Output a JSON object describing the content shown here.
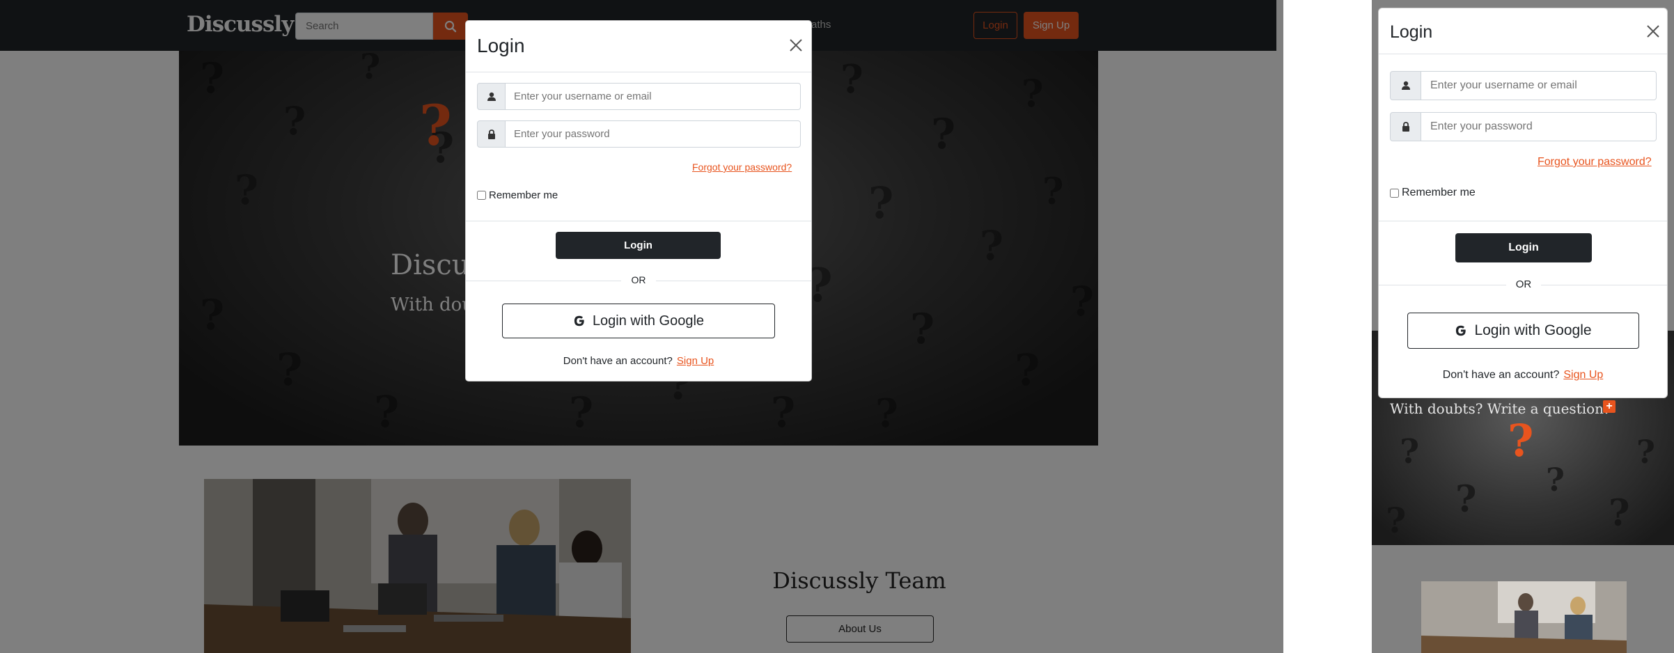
{
  "navbar": {
    "brand": "Discussly",
    "search_placeholder": "Search",
    "partial_link": "aths",
    "login_label": "Login",
    "signup_label": "Sign Up"
  },
  "hero": {
    "title": "Discussly",
    "subtitle": "With doubts? Write a question!"
  },
  "team": {
    "title": "Discussly Team",
    "about_label": "About Us"
  },
  "login_modal": {
    "title": "Login",
    "username_placeholder": "Enter your username or email",
    "password_placeholder": "Enter your password",
    "forgot_label": "Forgot your password?",
    "remember_label": "Remember me",
    "login_button": "Login",
    "or_text": "OR",
    "google_button": "Login with Google",
    "no_account_text": "Don't have an account?",
    "signup_link": "Sign Up"
  },
  "mobile": {
    "hero_subtitle": "With doubts? Write a question!",
    "plus_icon": "+"
  },
  "colors": {
    "accent": "#e8541e",
    "dark": "#212529"
  },
  "icons": {
    "search": "search-icon",
    "close": "close-icon",
    "user": "user-icon",
    "lock": "lock-icon",
    "google": "google-icon"
  }
}
